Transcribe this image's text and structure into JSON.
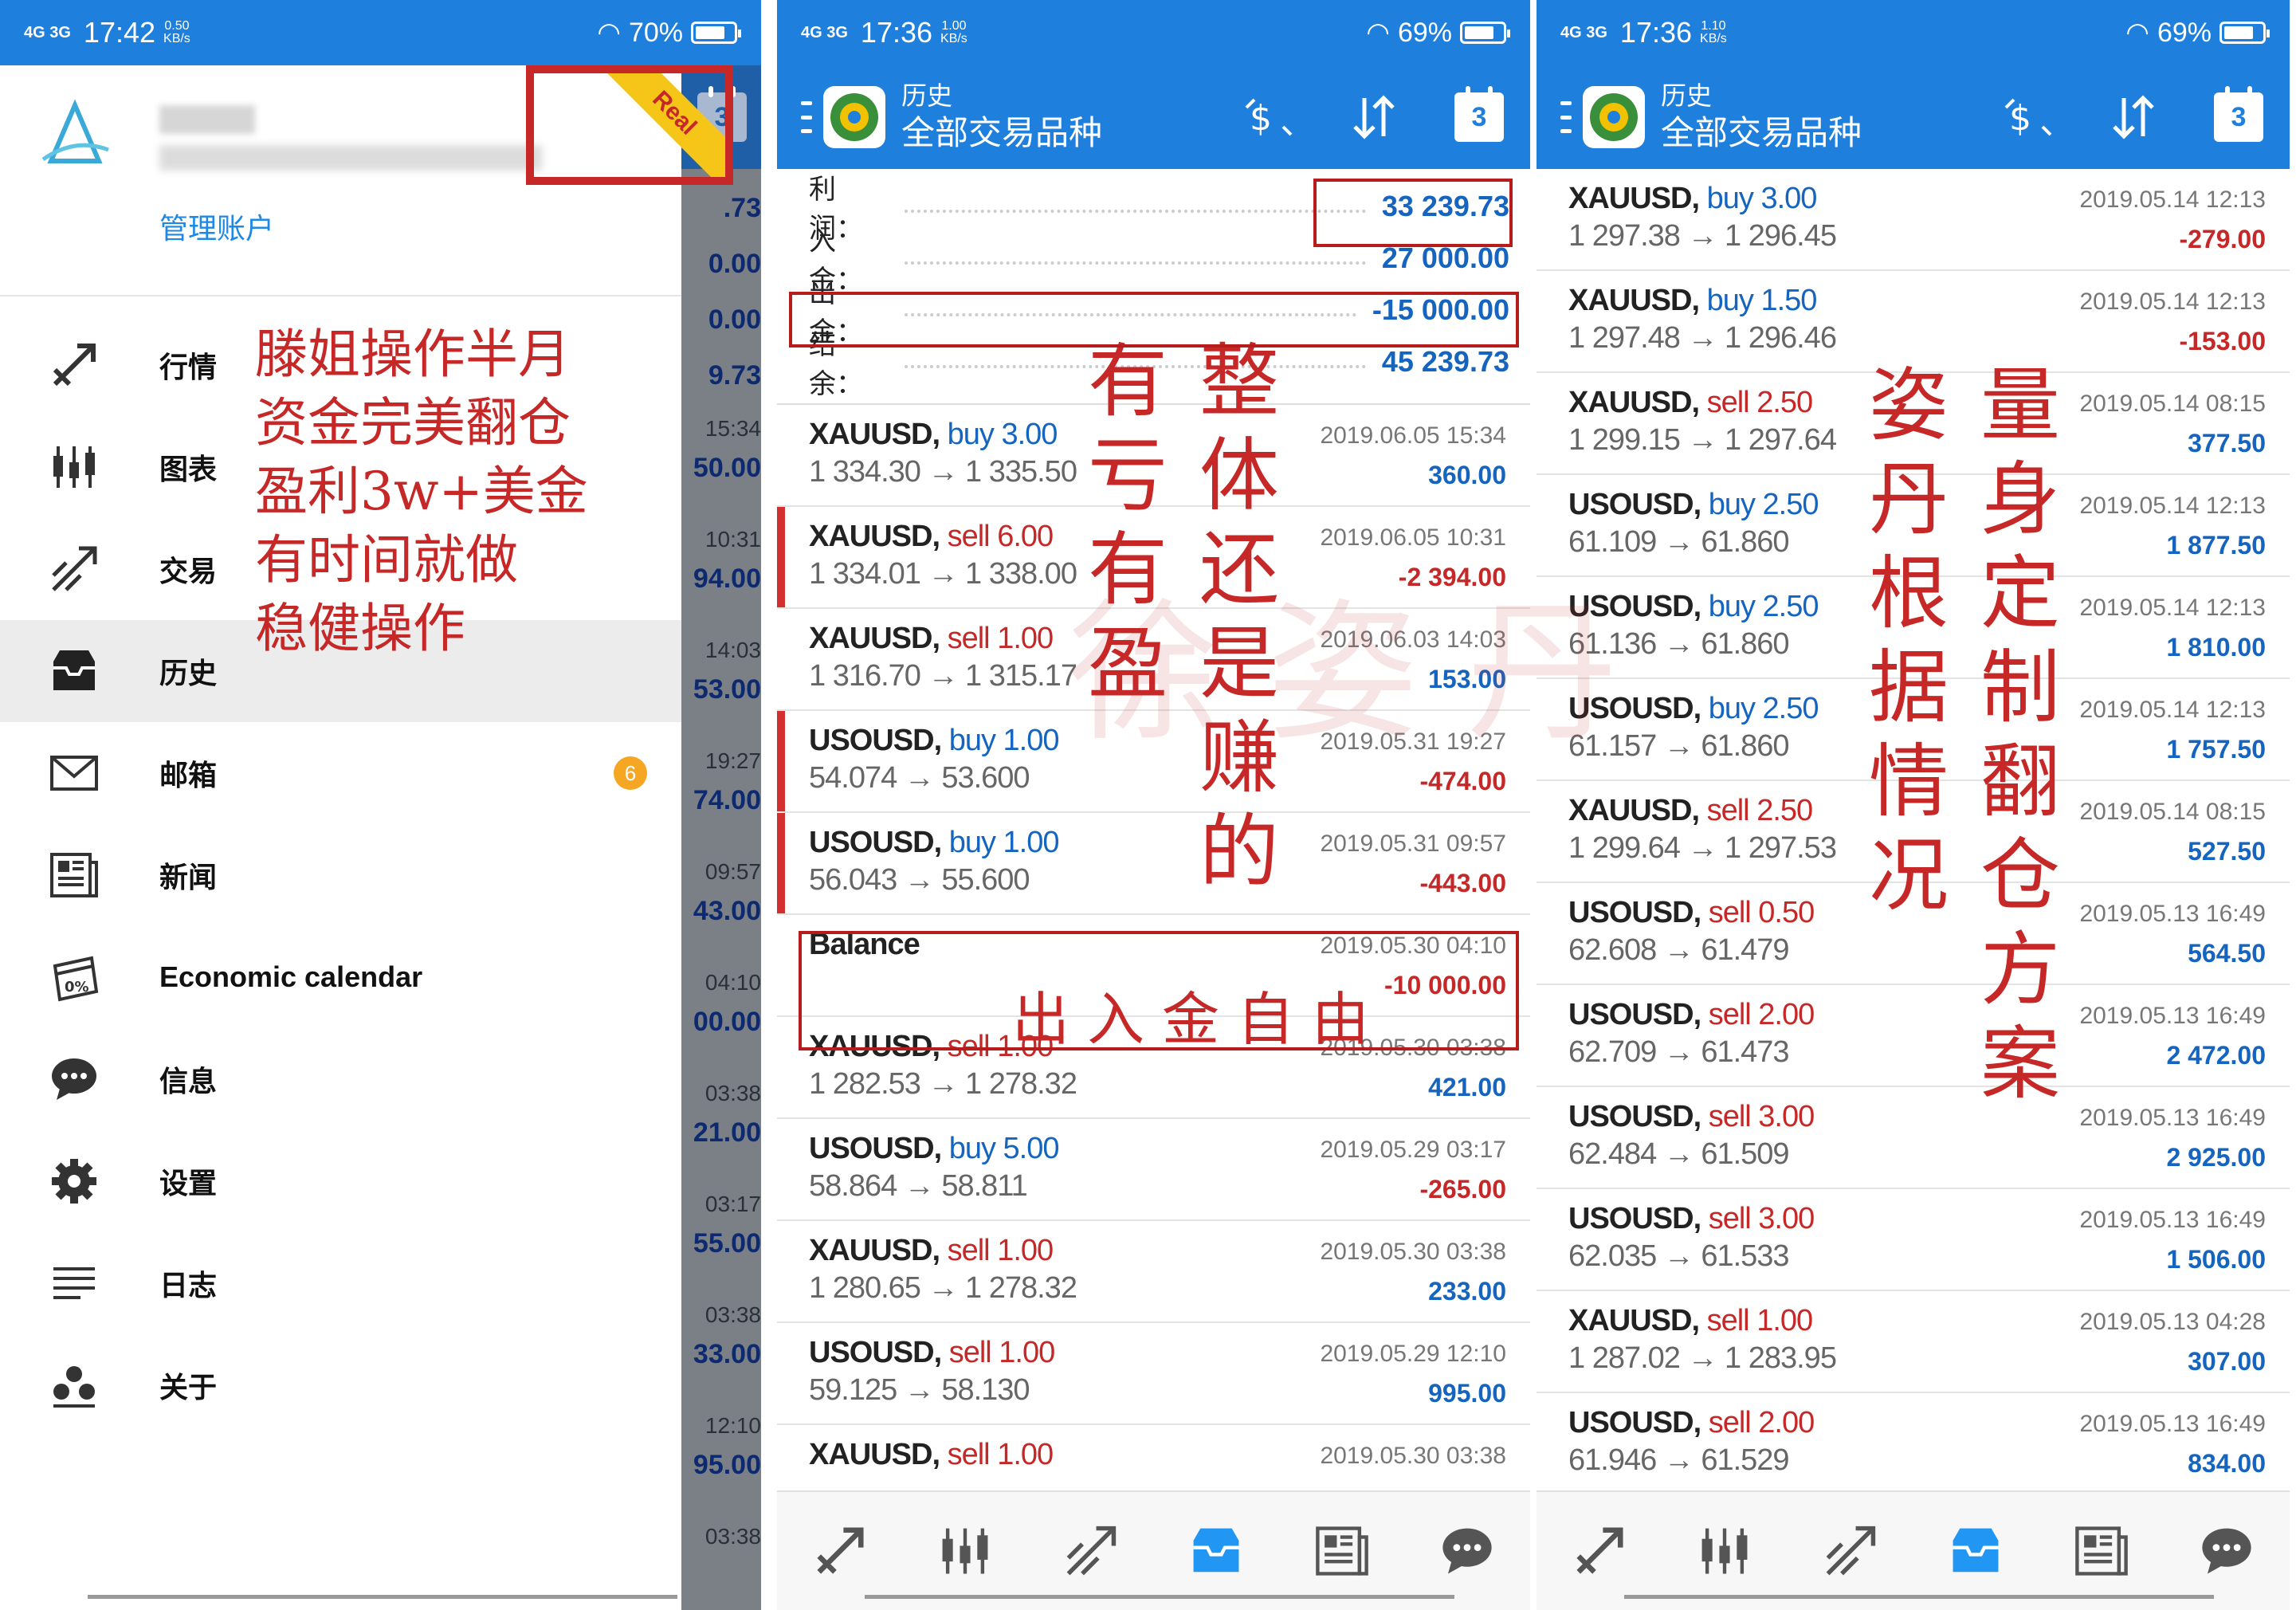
{
  "status_bar": [
    {
      "signal": "4G 3G",
      "time": "17:42",
      "speed": "0.50\nKB/s",
      "battery": "70%"
    },
    {
      "signal": "4G 3G",
      "time": "17:36",
      "speed": "1.00\nKB/s",
      "battery": "69%"
    },
    {
      "signal": "4G 3G",
      "time": "17:36",
      "speed": "1.10\nKB/s",
      "battery": "69%"
    }
  ],
  "drawer": {
    "manage_account": "管理账户",
    "ribbon": "Real",
    "calendar_badge": "3",
    "items": [
      {
        "label": "行情",
        "icon": "quotes-icon"
      },
      {
        "label": "图表",
        "icon": "chart-icon"
      },
      {
        "label": "交易",
        "icon": "trade-icon"
      },
      {
        "label": "历史",
        "icon": "history-icon",
        "selected": true
      },
      {
        "label": "邮箱",
        "icon": "mail-icon",
        "badge": "6"
      },
      {
        "label": "新闻",
        "icon": "news-icon"
      },
      {
        "label": "Economic calendar",
        "icon": "calendar-icon"
      },
      {
        "label": "信息",
        "icon": "chat-icon"
      },
      {
        "label": "设置",
        "icon": "gear-icon"
      },
      {
        "label": "日志",
        "icon": "journal-icon"
      },
      {
        "label": "关于",
        "icon": "about-icon"
      }
    ],
    "dimmed_values": [
      ".73",
      "0.00",
      "0.00",
      "9.73",
      "15:34",
      "50.00",
      "10:31",
      "94.00",
      "14:03",
      "53.00",
      "19:27",
      "74.00",
      "09:57",
      "43.00",
      "04:10",
      "00.00",
      "03:38",
      "21.00",
      "03:17",
      "55.00",
      "03:38",
      "33.00",
      "12:10",
      "95.00",
      "03:38"
    ],
    "note_lines": [
      "滕姐操作半月",
      "资金完美翻仓",
      "盈利3w+美金",
      "有时间就做",
      "稳健操作"
    ]
  },
  "header": {
    "subtitle": "历史",
    "title": "全部交易品种",
    "calendar_day": "3"
  },
  "summary": [
    {
      "label": "利润：",
      "value": "33 239.73"
    },
    {
      "label": "入金：",
      "value": "27 000.00"
    },
    {
      "label": "出金：",
      "value": "-15 000.00"
    },
    {
      "label": "结余：",
      "value": "45 239.73"
    }
  ],
  "trades_mid": [
    {
      "sym": "XAUUSD,",
      "side": "buy",
      "lot": "3.00",
      "px": "1 334.30 → 1 335.50",
      "dt": "2019.06.05 15:34",
      "pl": "360.00",
      "neg": false,
      "mark": false
    },
    {
      "sym": "XAUUSD,",
      "side": "sell",
      "lot": "6.00",
      "px": "1 334.01 → 1 338.00",
      "dt": "2019.06.05 10:31",
      "pl": "-2 394.00",
      "neg": true,
      "mark": true
    },
    {
      "sym": "XAUUSD,",
      "side": "sell",
      "lot": "1.00",
      "px": "1 316.70 → 1 315.17",
      "dt": "2019.06.03 14:03",
      "pl": "153.00",
      "neg": false,
      "mark": false
    },
    {
      "sym": "USOUSD,",
      "side": "buy",
      "lot": "1.00",
      "px": "54.074 → 53.600",
      "dt": "2019.05.31 19:27",
      "pl": "-474.00",
      "neg": true,
      "mark": true
    },
    {
      "sym": "USOUSD,",
      "side": "buy",
      "lot": "1.00",
      "px": "56.043 → 55.600",
      "dt": "2019.05.31 09:57",
      "pl": "-443.00",
      "neg": true,
      "mark": true
    },
    {
      "sym": "Balance",
      "side": "",
      "lot": "",
      "px": "",
      "dt": "2019.05.30 04:10",
      "pl": "-10 000.00",
      "neg": true,
      "mark": false
    },
    {
      "sym": "XAUUSD,",
      "side": "sell",
      "lot": "1.00",
      "px": "1 282.53 → 1 278.32",
      "dt": "2019.05.30 03:38",
      "pl": "421.00",
      "neg": false,
      "mark": false
    },
    {
      "sym": "USOUSD,",
      "side": "buy",
      "lot": "5.00",
      "px": "58.864 → 58.811",
      "dt": "2019.05.29 03:17",
      "pl": "-265.00",
      "neg": true,
      "mark": false
    },
    {
      "sym": "XAUUSD,",
      "side": "sell",
      "lot": "1.00",
      "px": "1 280.65 → 1 278.32",
      "dt": "2019.05.30 03:38",
      "pl": "233.00",
      "neg": false,
      "mark": false
    },
    {
      "sym": "USOUSD,",
      "side": "sell",
      "lot": "1.00",
      "px": "59.125 → 58.130",
      "dt": "2019.05.29 12:10",
      "pl": "995.00",
      "neg": false,
      "mark": false
    },
    {
      "sym": "XAUUSD,",
      "side": "sell",
      "lot": "1.00",
      "px": "",
      "dt": "2019.05.30 03:38",
      "pl": "",
      "neg": false,
      "mark": false
    }
  ],
  "trades_right": [
    {
      "sym": "XAUUSD,",
      "side": "buy",
      "lot": "3.00",
      "px": "1 297.38 → 1 296.45",
      "dt": "2019.05.14 12:13",
      "pl": "-279.00",
      "neg": true
    },
    {
      "sym": "XAUUSD,",
      "side": "buy",
      "lot": "1.50",
      "px": "1 297.48 → 1 296.46",
      "dt": "2019.05.14 12:13",
      "pl": "-153.00",
      "neg": true
    },
    {
      "sym": "XAUUSD,",
      "side": "sell",
      "lot": "2.50",
      "px": "1 299.15 → 1 297.64",
      "dt": "2019.05.14 08:15",
      "pl": "377.50",
      "neg": false
    },
    {
      "sym": "USOUSD,",
      "side": "buy",
      "lot": "2.50",
      "px": "61.109 → 61.860",
      "dt": "2019.05.14 12:13",
      "pl": "1 877.50",
      "neg": false
    },
    {
      "sym": "USOUSD,",
      "side": "buy",
      "lot": "2.50",
      "px": "61.136 → 61.860",
      "dt": "2019.05.14 12:13",
      "pl": "1 810.00",
      "neg": false
    },
    {
      "sym": "USOUSD,",
      "side": "buy",
      "lot": "2.50",
      "px": "61.157 → 61.860",
      "dt": "2019.05.14 12:13",
      "pl": "1 757.50",
      "neg": false
    },
    {
      "sym": "XAUUSD,",
      "side": "sell",
      "lot": "2.50",
      "px": "1 299.64 → 1 297.53",
      "dt": "2019.05.14 08:15",
      "pl": "527.50",
      "neg": false
    },
    {
      "sym": "USOUSD,",
      "side": "sell",
      "lot": "0.50",
      "px": "62.608 → 61.479",
      "dt": "2019.05.13 16:49",
      "pl": "564.50",
      "neg": false
    },
    {
      "sym": "USOUSD,",
      "side": "sell",
      "lot": "2.00",
      "px": "62.709 → 61.473",
      "dt": "2019.05.13 16:49",
      "pl": "2 472.00",
      "neg": false
    },
    {
      "sym": "USOUSD,",
      "side": "sell",
      "lot": "3.00",
      "px": "62.484 → 61.509",
      "dt": "2019.05.13 16:49",
      "pl": "2 925.00",
      "neg": false
    },
    {
      "sym": "USOUSD,",
      "side": "sell",
      "lot": "3.00",
      "px": "62.035 → 61.533",
      "dt": "2019.05.13 16:49",
      "pl": "1 506.00",
      "neg": false
    },
    {
      "sym": "XAUUSD,",
      "side": "sell",
      "lot": "1.00",
      "px": "1 287.02 → 1 283.95",
      "dt": "2019.05.13 04:28",
      "pl": "307.00",
      "neg": false
    },
    {
      "sym": "USOUSD,",
      "side": "sell",
      "lot": "2.00",
      "px": "61.946 → 61.529",
      "dt": "2019.05.13 16:49",
      "pl": "834.00",
      "neg": false
    }
  ],
  "annotations": {
    "mid_col1": "有亏有盈",
    "mid_col2": "整体还是赚的",
    "mid_line": "出入金自由",
    "right_col1": "姿丹根据情况",
    "right_col2": "量身定制翻仓方案",
    "watermark": "徐姿丹"
  },
  "colors": {
    "accent": "#1e7fdc",
    "positive": "#1565c0",
    "negative": "#c62828",
    "annotation": "#c62828"
  }
}
